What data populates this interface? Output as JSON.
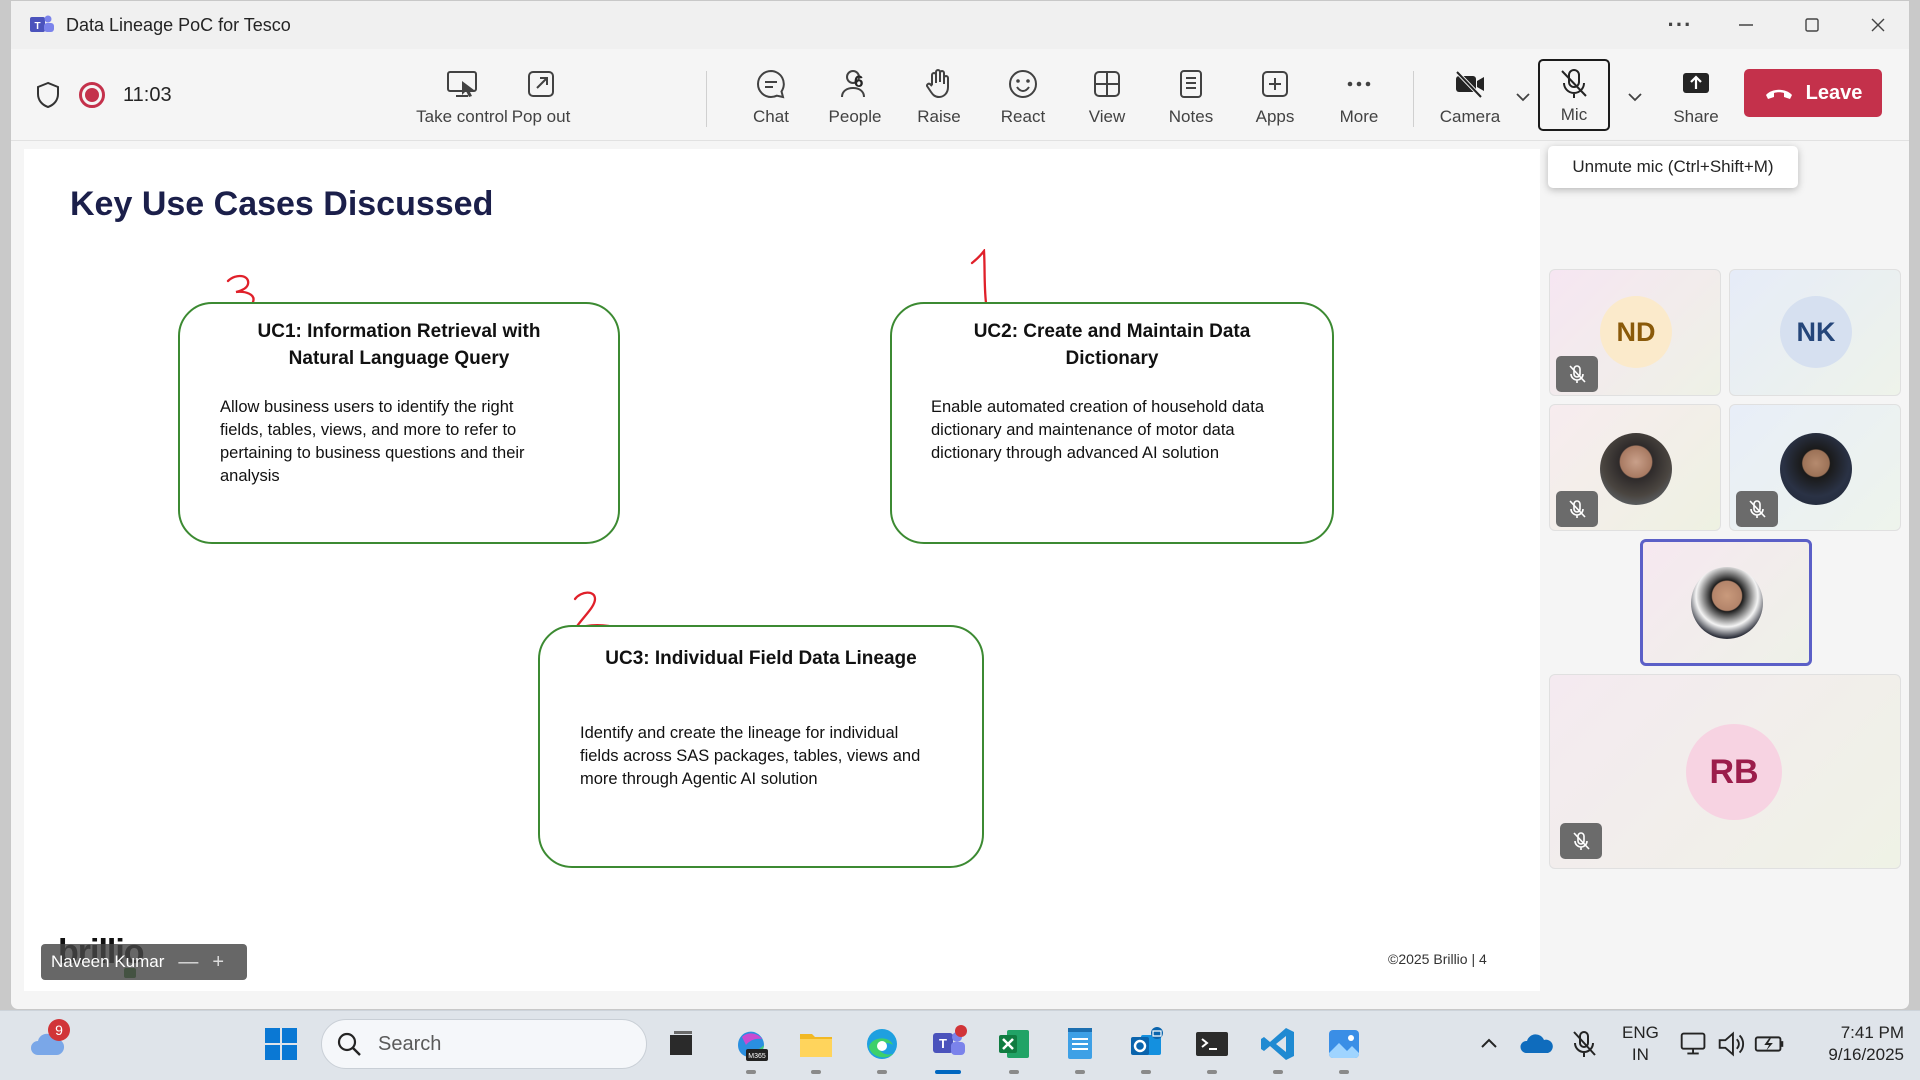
{
  "window": {
    "title": "Data Lineage PoC for Tesco",
    "more_glyph": "···"
  },
  "toolbar": {
    "timer": "11:03",
    "take_control": "Take control",
    "pop_out": "Pop out",
    "chat": "Chat",
    "people": "People",
    "people_count": "6",
    "raise": "Raise",
    "react": "React",
    "view": "View",
    "notes": "Notes",
    "apps": "Apps",
    "more": "More",
    "camera": "Camera",
    "mic": "Mic",
    "share": "Share",
    "leave": "Leave",
    "mic_tooltip": "Unmute mic (Ctrl+Shift+M)"
  },
  "slide": {
    "title": "Key Use Cases Discussed",
    "use_cases": [
      {
        "mark": "3",
        "title_line1": "UC1: Information Retrieval with",
        "title_line2": "Natural Language Query",
        "lines": [
          "Allow business users to identify the right",
          "fields, tables, views, and more to refer to",
          "pertaining to business questions and their",
          "analysis"
        ]
      },
      {
        "mark": "1",
        "title_line1": "UC2: Create and Maintain Data",
        "title_line2": "Dictionary",
        "lines": [
          "Enable automated creation of household data",
          "dictionary and maintenance of motor data",
          "dictionary through advanced AI solution"
        ]
      },
      {
        "mark": "2",
        "title_line1": "UC3: Individual Field Data Lineage",
        "lines": [
          "Identify and create the lineage for individual",
          "fields across SAS packages, tables, views and",
          "more through Agentic AI solution"
        ]
      }
    ],
    "footer": "©2025 Brillio  |  4",
    "logo_text": "brillio",
    "presenter_name": "Naveen Kumar"
  },
  "participants": [
    {
      "initials": "ND",
      "muted": true,
      "avatar_bg": "#fbeacb",
      "initials_color": "#8a5a0a"
    },
    {
      "initials": "NK",
      "muted": false,
      "avatar_bg": "#d6e0f0",
      "initials_color": "#25467a"
    },
    {
      "initials": "",
      "muted": true,
      "photo": true
    },
    {
      "initials": "",
      "muted": true,
      "photo": true
    },
    {
      "initials": "",
      "muted": false,
      "photo": true,
      "active": true
    },
    {
      "initials": "RB",
      "muted": true,
      "avatar_bg": "#f7d3e2",
      "initials_color": "#9b1d4b"
    }
  ],
  "taskbar": {
    "weather_badge": "9",
    "search_placeholder": "Search",
    "lang_line1": "ENG",
    "lang_line2": "IN",
    "time": "7:41 PM",
    "date": "9/16/2025",
    "m365_label": "M365"
  },
  "colors": {
    "leave": "#c4314b",
    "accent": "#5b5fc7",
    "box_border": "#3c8a32",
    "annotation": "#e0202a"
  }
}
